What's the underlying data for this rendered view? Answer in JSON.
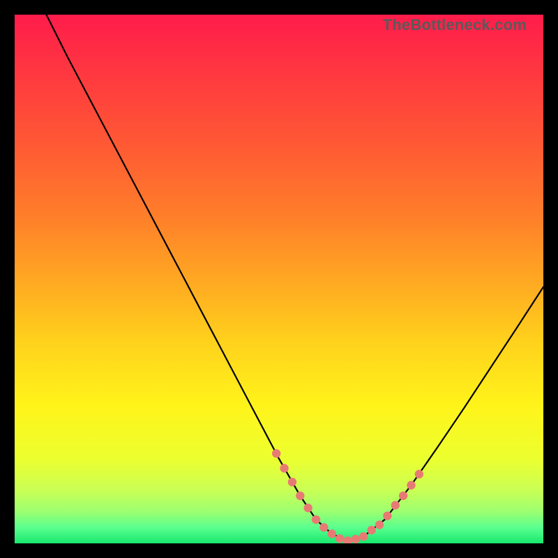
{
  "watermark": "TheBottleneck.com",
  "chart_data": {
    "type": "line",
    "title": "",
    "xlabel": "",
    "ylabel": "",
    "xlim": [
      0,
      100
    ],
    "ylim": [
      0,
      100
    ],
    "grid": false,
    "legend": false,
    "background_gradient": {
      "stops": [
        {
          "offset": 0.0,
          "color": "#ff1c4b"
        },
        {
          "offset": 0.12,
          "color": "#ff3a3f"
        },
        {
          "offset": 0.25,
          "color": "#ff5a34"
        },
        {
          "offset": 0.38,
          "color": "#ff7e2a"
        },
        {
          "offset": 0.5,
          "color": "#ffa722"
        },
        {
          "offset": 0.62,
          "color": "#ffd21c"
        },
        {
          "offset": 0.74,
          "color": "#fff41a"
        },
        {
          "offset": 0.84,
          "color": "#ecff2f"
        },
        {
          "offset": 0.9,
          "color": "#c9ff55"
        },
        {
          "offset": 0.94,
          "color": "#9cff70"
        },
        {
          "offset": 0.97,
          "color": "#5bff8f"
        },
        {
          "offset": 1.0,
          "color": "#17e86f"
        }
      ]
    },
    "series": [
      {
        "name": "bottleneck-curve",
        "color": "#000000",
        "x": [
          6,
          10,
          15,
          20,
          25,
          30,
          35,
          40,
          45,
          50,
          54,
          57,
          60,
          63,
          66,
          70,
          75,
          80,
          85,
          90,
          95,
          100
        ],
        "y": [
          100,
          92,
          82.5,
          73,
          63.5,
          54,
          44.5,
          35,
          25.5,
          16,
          9,
          4.5,
          1.8,
          0.5,
          1.3,
          4.5,
          11,
          18.2,
          25.6,
          33.2,
          40.8,
          48.5
        ]
      }
    ],
    "markers": {
      "name": "highlight-dots",
      "color": "#e77b74",
      "radius_px": 6.2,
      "x": [
        49.5,
        51,
        52.5,
        54,
        55.5,
        57,
        58.5,
        60,
        61.5,
        63,
        64.5,
        66,
        67.5,
        69,
        70.5,
        72,
        73.5,
        75,
        76.5
      ],
      "y": [
        17.0,
        14.2,
        11.6,
        9.0,
        6.7,
        4.5,
        3.0,
        1.8,
        0.9,
        0.5,
        0.8,
        1.3,
        2.5,
        3.5,
        5.2,
        7.2,
        9.0,
        11.0,
        13.1
      ]
    }
  }
}
